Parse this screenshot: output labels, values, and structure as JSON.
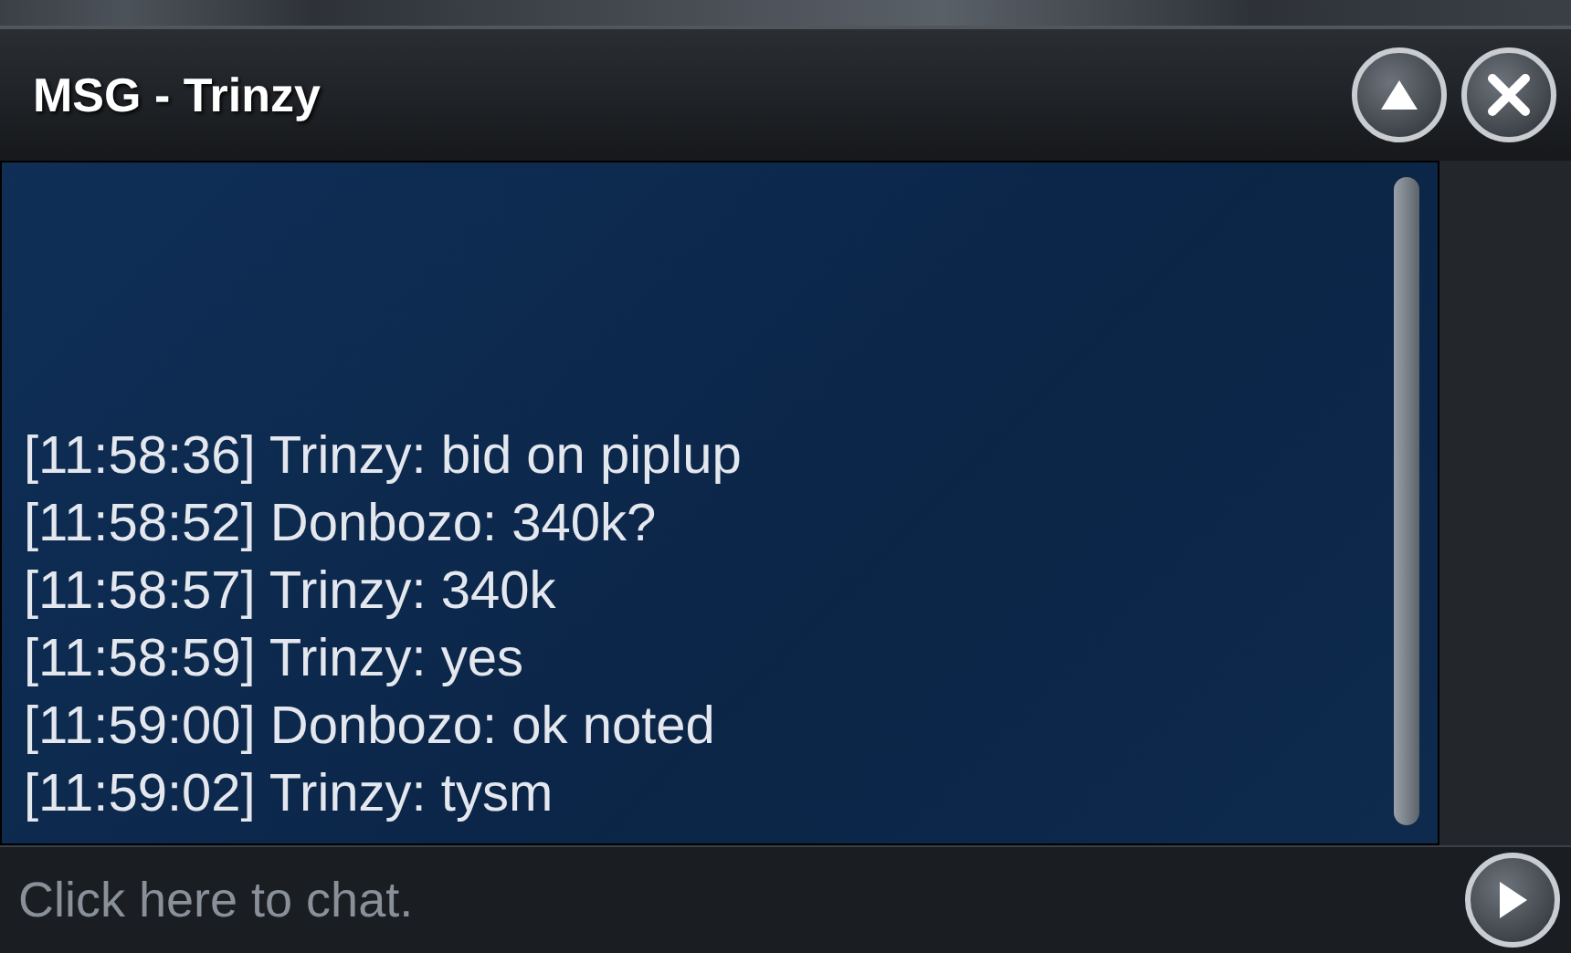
{
  "window": {
    "title": "MSG - Trinzy"
  },
  "messages": [
    {
      "time": "[11:58:36]",
      "sender": "Trinzy:",
      "text": "bid on piplup"
    },
    {
      "time": "[11:58:52]",
      "sender": "Donbozo:",
      "text": "340k?"
    },
    {
      "time": "[11:58:57]",
      "sender": "Trinzy:",
      "text": "340k"
    },
    {
      "time": "[11:58:59]",
      "sender": "Trinzy:",
      "text": "yes"
    },
    {
      "time": "[11:59:00]",
      "sender": "Donbozo:",
      "text": "ok noted"
    },
    {
      "time": "[11:59:02]",
      "sender": "Trinzy:",
      "text": "tysm"
    }
  ],
  "chat_input": {
    "placeholder": "Click here to chat."
  }
}
